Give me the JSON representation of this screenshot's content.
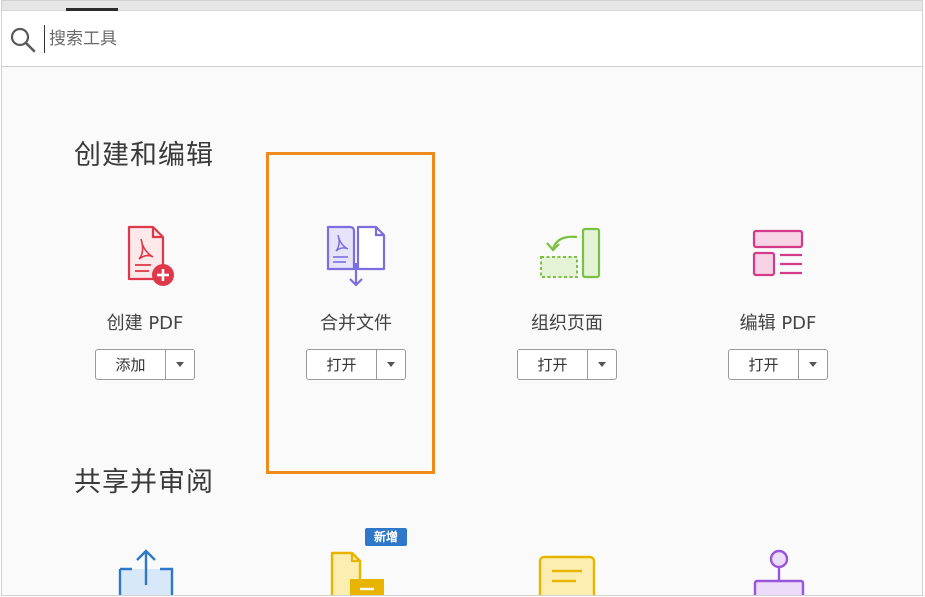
{
  "search": {
    "placeholder": "搜索工具"
  },
  "sections": [
    {
      "title": "创建和编辑"
    },
    {
      "title": "共享并审阅"
    }
  ],
  "tools": [
    {
      "label": "创建 PDF",
      "button": "添加",
      "icon": "create-pdf-icon",
      "color": "#e0384b"
    },
    {
      "label": "合并文件",
      "button": "打开",
      "icon": "combine-files-icon",
      "color": "#7a6ee0"
    },
    {
      "label": "组织页面",
      "button": "打开",
      "icon": "organize-pages-icon",
      "color": "#7ac143"
    },
    {
      "label": "编辑 PDF",
      "button": "打开",
      "icon": "edit-pdf-icon",
      "color": "#d23b8a"
    }
  ],
  "share_tools": [
    {
      "icon": "share-icon",
      "color": "#2d78c8"
    },
    {
      "icon": "send-for-comments-icon",
      "color": "#e8b400",
      "badge": "新增"
    },
    {
      "icon": "comment-icon",
      "color": "#e8b400"
    },
    {
      "icon": "stamp-icon",
      "color": "#9a56d8"
    }
  ]
}
